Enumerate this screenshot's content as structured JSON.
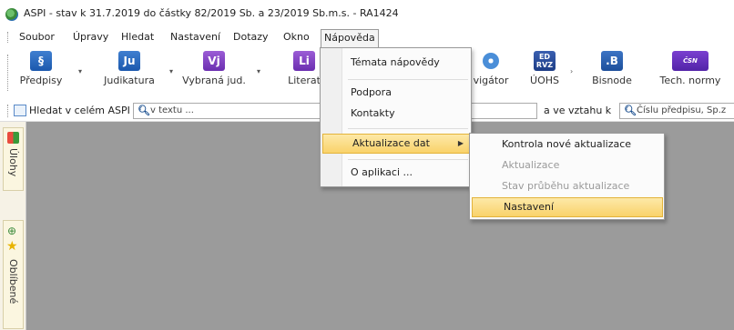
{
  "window": {
    "title": "ASPI  - stav k 31.7.2019 do částky 82/2019 Sb. a 23/2019 Sb.m.s. - RA1424"
  },
  "menubar": {
    "items": [
      "Soubor",
      "Úpravy",
      "Hledat",
      "Nastavení",
      "Dotazy",
      "Okno",
      "Nápověda"
    ]
  },
  "toolbar": {
    "buttons": [
      {
        "icon_text": "§",
        "label": "Předpisy",
        "icon": "predpisy-icon"
      },
      {
        "icon_text": "Ju",
        "label": "Judikatura",
        "icon": "judikatura-icon"
      },
      {
        "icon_text": "Vj",
        "label": "Vybraná jud.",
        "icon": "vybrana-jud-icon"
      },
      {
        "icon_text": "Li",
        "label": "Literat",
        "icon": "literatura-icon"
      },
      {
        "icon_text": "",
        "label": "vigátor",
        "icon": "navigator-icon"
      },
      {
        "icon_text": "ED RVZ",
        "label": "ÚOHS",
        "icon": "uohs-icon"
      },
      {
        "icon_text": ".B",
        "label": "Bisnode",
        "icon": "bisnode-icon"
      },
      {
        "icon_text": "ČSN",
        "label": "Tech. normy",
        "icon": "tech-normy-icon"
      }
    ]
  },
  "searchbar": {
    "label": "Hledat v celém ASPI",
    "text_placeholder": "v textu ...",
    "relation_label": "a ve vztahu k",
    "number_placeholder": "Číslu předpisu, Sp.z"
  },
  "sidebar": {
    "tab_ulohy": "Úlohy",
    "tab_oblibene": "Oblíbené"
  },
  "dropdown": {
    "items": [
      "Témata nápovědy",
      "Podpora",
      "Kontakty",
      "Aktualizace dat",
      "O aplikaci ..."
    ]
  },
  "submenu": {
    "items": [
      "Kontrola nové aktualizace",
      "Aktualizace",
      "Stav průběhu aktualizace",
      "Nastavení"
    ]
  },
  "colors": {
    "highlight": "#f9d26a",
    "workspace": "#9b9b9b",
    "toolbar_blue": "#1b58ad"
  }
}
